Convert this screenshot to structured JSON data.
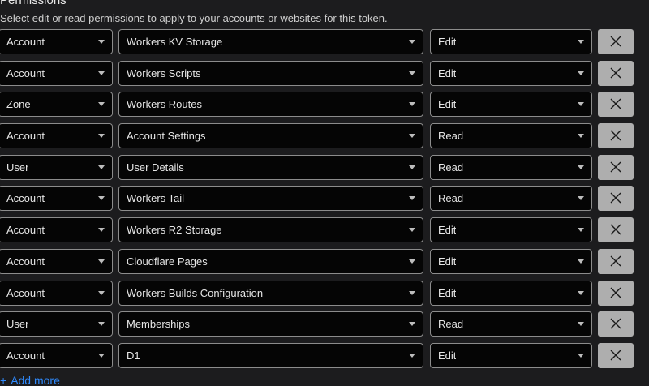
{
  "section": {
    "title": "Permissions",
    "subtitle": "Select edit or read permissions to apply to your accounts or websites for this token."
  },
  "rows": [
    {
      "scope": "Account",
      "resource": "Workers KV Storage",
      "permission": "Edit"
    },
    {
      "scope": "Account",
      "resource": "Workers Scripts",
      "permission": "Edit"
    },
    {
      "scope": "Zone",
      "resource": "Workers Routes",
      "permission": "Edit"
    },
    {
      "scope": "Account",
      "resource": "Account Settings",
      "permission": "Read"
    },
    {
      "scope": "User",
      "resource": "User Details",
      "permission": "Read"
    },
    {
      "scope": "Account",
      "resource": "Workers Tail",
      "permission": "Read"
    },
    {
      "scope": "Account",
      "resource": "Workers R2 Storage",
      "permission": "Edit"
    },
    {
      "scope": "Account",
      "resource": "Cloudflare Pages",
      "permission": "Edit"
    },
    {
      "scope": "Account",
      "resource": "Workers Builds Configuration",
      "permission": "Edit"
    },
    {
      "scope": "User",
      "resource": "Memberships",
      "permission": "Read"
    },
    {
      "scope": "Account",
      "resource": "D1",
      "permission": "Edit"
    }
  ],
  "add_more": {
    "icon": "+",
    "label": "Add more"
  },
  "colors": {
    "background": "#1c1c1e",
    "select_background": "#050505",
    "select_border": "#8c8c8c",
    "remove_button": "#aeaeae",
    "link": "#2f8bff"
  }
}
